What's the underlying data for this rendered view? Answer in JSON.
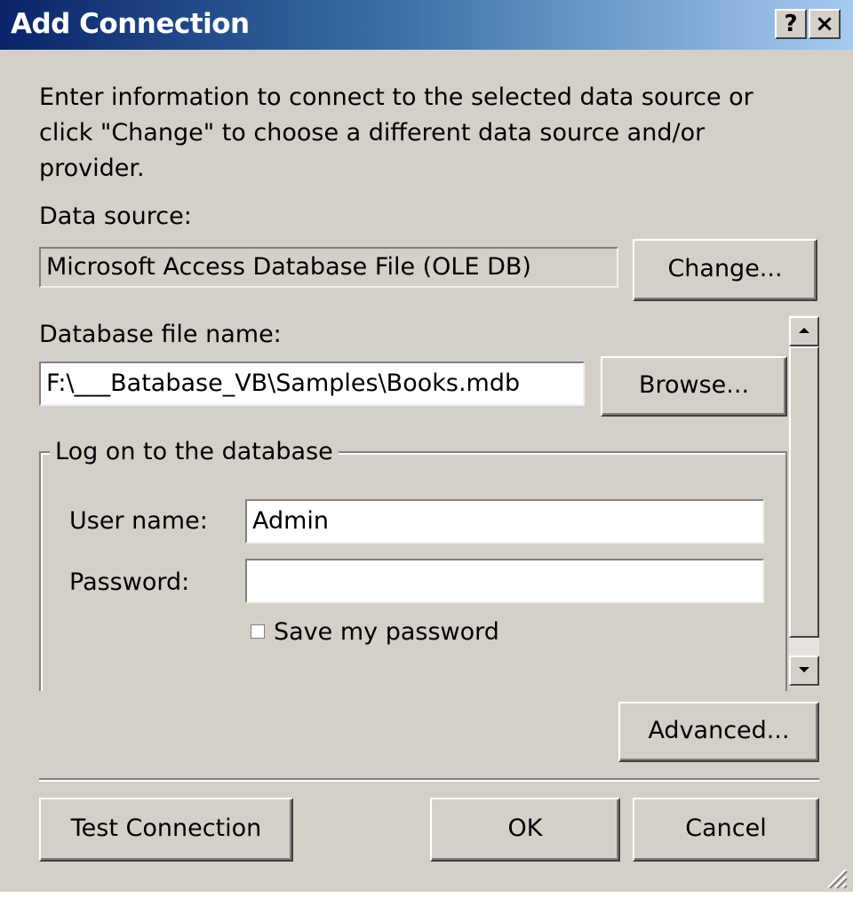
{
  "window": {
    "title": "Add Connection",
    "help_label": "?",
    "close_label": "×"
  },
  "description": "Enter information to connect to the selected data source or click \"Change\" to choose a different data source and/or provider.",
  "data_source": {
    "label": "Data source:",
    "value": "Microsoft Access Database File (OLE DB)",
    "change_label": "Change..."
  },
  "database_file": {
    "label": "Database file name:",
    "value": "F:\\___Batabase_VB\\Samples\\Books.mdb",
    "browse_label": "Browse..."
  },
  "logon": {
    "group_title": "Log on to the database",
    "user_label": "User name:",
    "user_value": "Admin",
    "password_label": "Password:",
    "password_value": "",
    "save_password_label": "Save my password",
    "save_password_checked": false
  },
  "buttons": {
    "advanced": "Advanced...",
    "test": "Test Connection",
    "ok": "OK",
    "cancel": "Cancel"
  },
  "icons": {
    "scroll_up": "scroll-up-arrow-icon",
    "scroll_down": "scroll-down-arrow-icon",
    "resize": "resize-grip-icon"
  },
  "colors": {
    "face": "#d4d0c8",
    "title_start": "#0a246a",
    "title_end": "#a6caf0"
  }
}
